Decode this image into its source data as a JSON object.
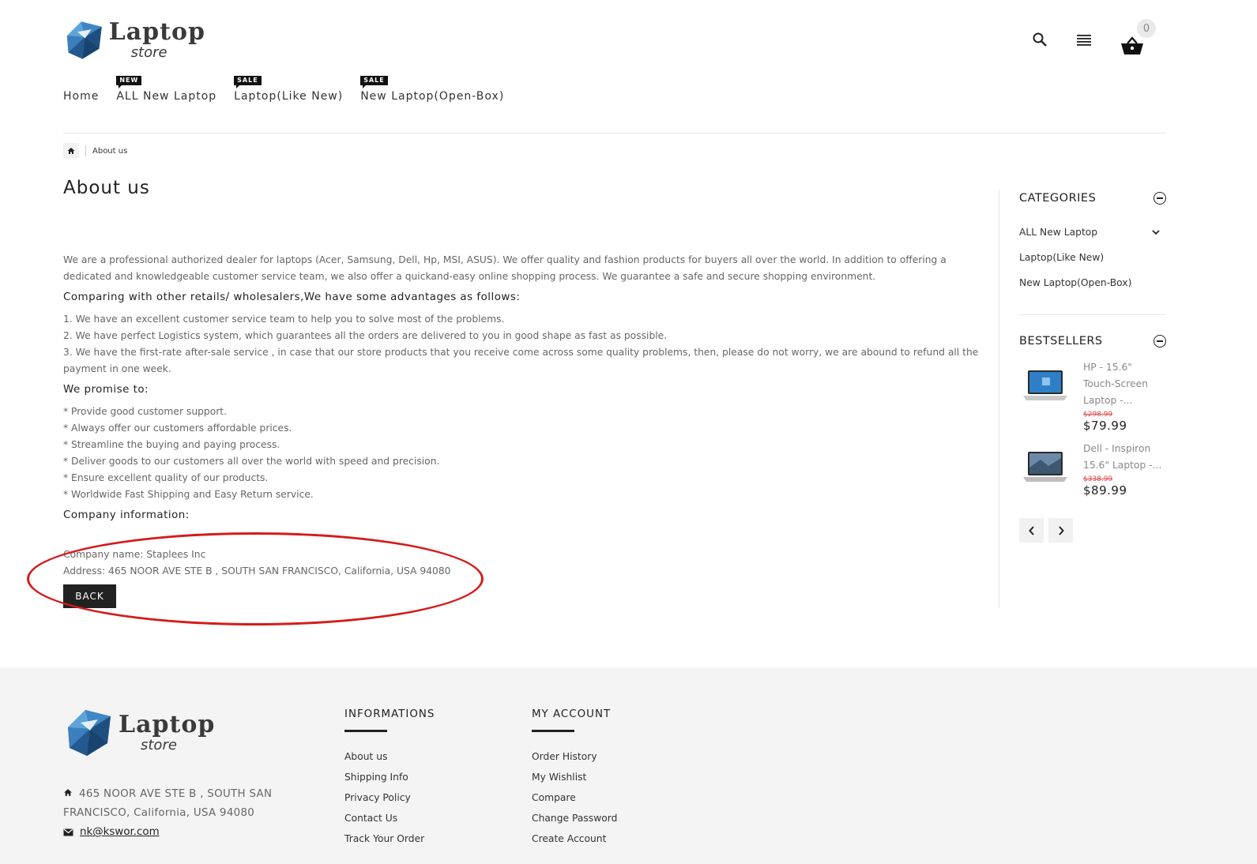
{
  "brand": {
    "name": "Laptop",
    "tagline": "store"
  },
  "header": {
    "cart_count": "0"
  },
  "nav": [
    {
      "label": "Home",
      "badge": ""
    },
    {
      "label": "ALL New Laptop",
      "badge": "NEW"
    },
    {
      "label": "Laptop(Like New)",
      "badge": "SALE"
    },
    {
      "label": "New Laptop(Open-Box)",
      "badge": "SALE"
    }
  ],
  "breadcrumb": {
    "current": "About us"
  },
  "page": {
    "title": "About us",
    "intro": "We are a professional authorized dealer for laptops (Acer, Samsung, Dell, Hp, MSI, ASUS). We offer quality and fashion products for buyers all over the world. In addition to offering a dedicated and knowledgeable customer service team, we also offer a quickand-easy online shopping process. We guarantee a safe and secure shopping environment.",
    "advantages_heading": "Comparing with other retails/ wholesalers,We have some advantages as follows:",
    "advantages": [
      "1. We have an excellent customer service team to help you to solve most of the problems.",
      "2. We have perfect Logistics system, which guarantees all the orders are delivered to you in good shape as fast as possible.",
      "3. We have the first-rate after-sale service , in case that our store products that you receive come across some quality problems, then, please do not worry, we are abound to refund all the payment in one week."
    ],
    "promise_heading": "We promise to:",
    "promises": [
      "* Provide good customer support.",
      "* Always offer our customers affordable prices.",
      "* Streamline the buying and paying process.",
      "* Deliver goods to our customers all over the world with speed and precision.",
      "* Ensure excellent quality of our products.",
      "* Worldwide Fast Shipping and Easy Return service."
    ],
    "company_heading": "Company information:",
    "company_name": "Company name: Staplees Inc",
    "company_address": "Address: 465 NOOR AVE STE B , SOUTH SAN FRANCISCO, California, USA 94080",
    "back_label": "BACK"
  },
  "sidebar": {
    "categories_title": "CATEGORIES",
    "categories": [
      {
        "label": "ALL New Laptop"
      },
      {
        "label": "Laptop(Like New)"
      },
      {
        "label": "New Laptop(Open-Box)"
      }
    ],
    "bestsellers_title": "BESTSELLERS",
    "bestsellers": [
      {
        "name": "HP - 15.6\" Touch-Screen Laptop -...",
        "old_price": "$298.99",
        "price": "$79.99"
      },
      {
        "name": "Dell - Inspiron 15.6\" Laptop -...",
        "old_price": "$338.99",
        "price": "$89.99"
      }
    ]
  },
  "footer": {
    "address": "465 NOOR AVE STE B , SOUTH SAN FRANCISCO, California, USA 94080",
    "email": "nk@kswor.com",
    "informations": {
      "title": "INFORMATIONS",
      "links": [
        "About us",
        "Shipping Info",
        "Privacy Policy",
        "Contact Us",
        "Track Your Order"
      ]
    },
    "account": {
      "title": "MY ACCOUNT",
      "links": [
        "Order History",
        "My Wishlist",
        "Compare",
        "Change Password",
        "Create Account"
      ]
    }
  },
  "colors": {
    "accent": "#222222",
    "sale_red": "#e04848",
    "highlight": "#d51b1b",
    "footer_bg": "#f4f4f4"
  }
}
